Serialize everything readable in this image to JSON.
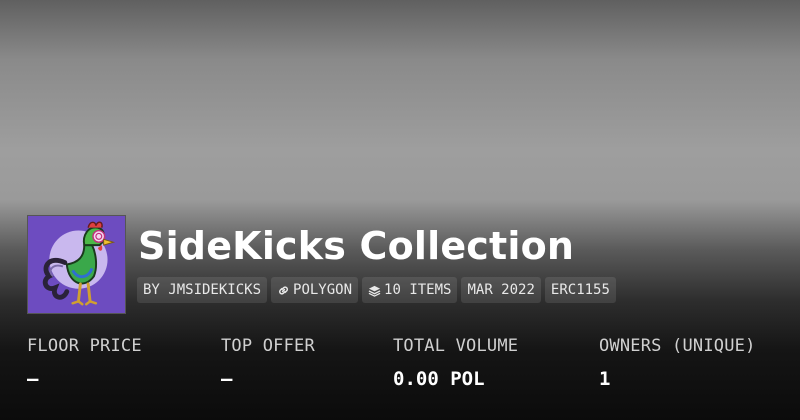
{
  "collection": {
    "title": "SideKicks Collection",
    "badges": {
      "creator": "BY JMSIDEKICKS",
      "chain": "POLYGON",
      "items": "10 ITEMS",
      "date": "MAR 2022",
      "standard": "ERC1155"
    }
  },
  "stats": [
    {
      "label": "FLOOR PRICE",
      "value": "—"
    },
    {
      "label": "TOP OFFER",
      "value": "—"
    },
    {
      "label": "TOTAL VOLUME",
      "value": "0.00 POL"
    },
    {
      "label": "OWNERS (UNIQUE)",
      "value": "1"
    }
  ],
  "icons": {
    "chain": "link-icon",
    "items": "layers-icon"
  },
  "colors": {
    "avatar_background": "#6d4cc0",
    "text": "#ffffff"
  }
}
